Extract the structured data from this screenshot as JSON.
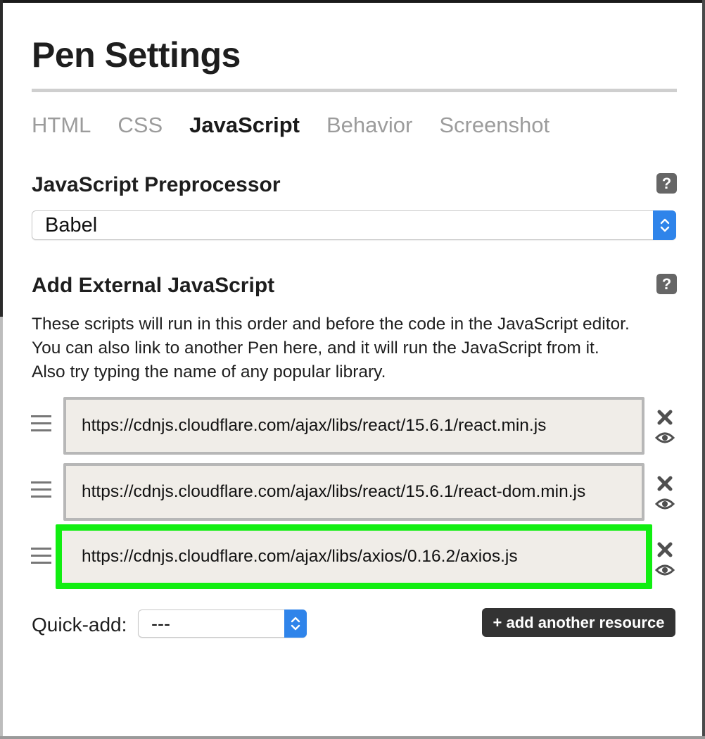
{
  "dialog": {
    "title": "Pen Settings"
  },
  "tabs": [
    {
      "label": "HTML",
      "active": false
    },
    {
      "label": "CSS",
      "active": false
    },
    {
      "label": "JavaScript",
      "active": true
    },
    {
      "label": "Behavior",
      "active": false
    },
    {
      "label": "Screenshot",
      "active": false
    }
  ],
  "preprocessor": {
    "heading": "JavaScript Preprocessor",
    "help": "?",
    "selected": "Babel"
  },
  "external": {
    "heading": "Add External JavaScript",
    "help": "?",
    "description": [
      "These scripts will run in this order and before the code in the JavaScript editor.",
      "You can also link to another Pen here, and it will run the JavaScript from it.",
      "Also try typing the name of any popular library."
    ],
    "resources": [
      {
        "url": "https://cdnjs.cloudflare.com/ajax/libs/react/15.6.1/react.min.js",
        "highlighted": false
      },
      {
        "url": "https://cdnjs.cloudflare.com/ajax/libs/react/15.6.1/react-dom.min.js",
        "highlighted": false
      },
      {
        "url": "https://cdnjs.cloudflare.com/ajax/libs/axios/0.16.2/axios.js",
        "highlighted": true
      }
    ],
    "icons": {
      "remove": "close-x-icon",
      "view": "eye-icon",
      "drag": "drag-handle-icon"
    }
  },
  "quick_add": {
    "label": "Quick-add:",
    "selected": "---"
  },
  "add_resource_label": "+ add another resource",
  "colors": {
    "highlight": "#11ee11",
    "select_accent": "#2f84ea",
    "button_bg": "#333333",
    "resource_bg": "#f0ede8"
  }
}
